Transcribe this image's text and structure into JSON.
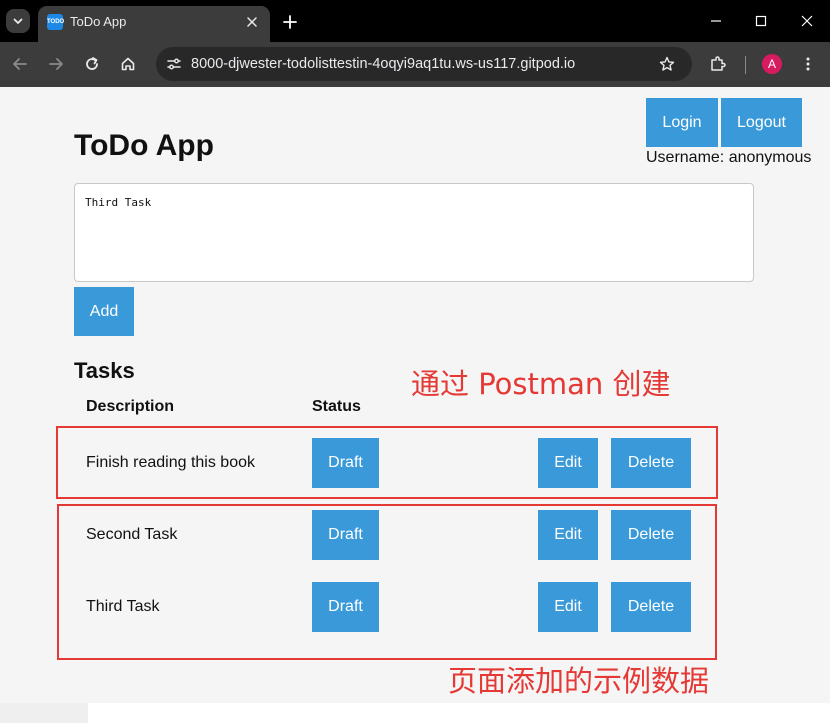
{
  "browser": {
    "tab_title": "ToDo App",
    "tab_favicon_text": "TODO",
    "url": "8000-djwester-todolisttestin-4oqyi9aq1tu.ws-us117.gitpod.io",
    "avatar_letter": "A"
  },
  "app": {
    "title": "ToDo App",
    "login_label": "Login",
    "logout_label": "Logout",
    "username_text": "Username: anonymous",
    "input_value": "Third Task",
    "add_label": "Add",
    "tasks_heading": "Tasks",
    "columns": {
      "description": "Description",
      "status": "Status"
    },
    "tasks": [
      {
        "description": "Finish reading this book",
        "status": "Draft",
        "edit_label": "Edit",
        "delete_label": "Delete"
      },
      {
        "description": "Second Task",
        "status": "Draft",
        "edit_label": "Edit",
        "delete_label": "Delete"
      },
      {
        "description": "Third Task",
        "status": "Draft",
        "edit_label": "Edit",
        "delete_label": "Delete"
      }
    ]
  },
  "annotations": {
    "postman": "通过 Postman 创建",
    "page_added": "页面添加的示例数据",
    "color": "#e53935"
  },
  "colors": {
    "button": "#3a9ad9",
    "page_bg": "#f5f5f5",
    "chrome_bg": "#3c3c3c",
    "tab_strip_bg": "#000000"
  }
}
